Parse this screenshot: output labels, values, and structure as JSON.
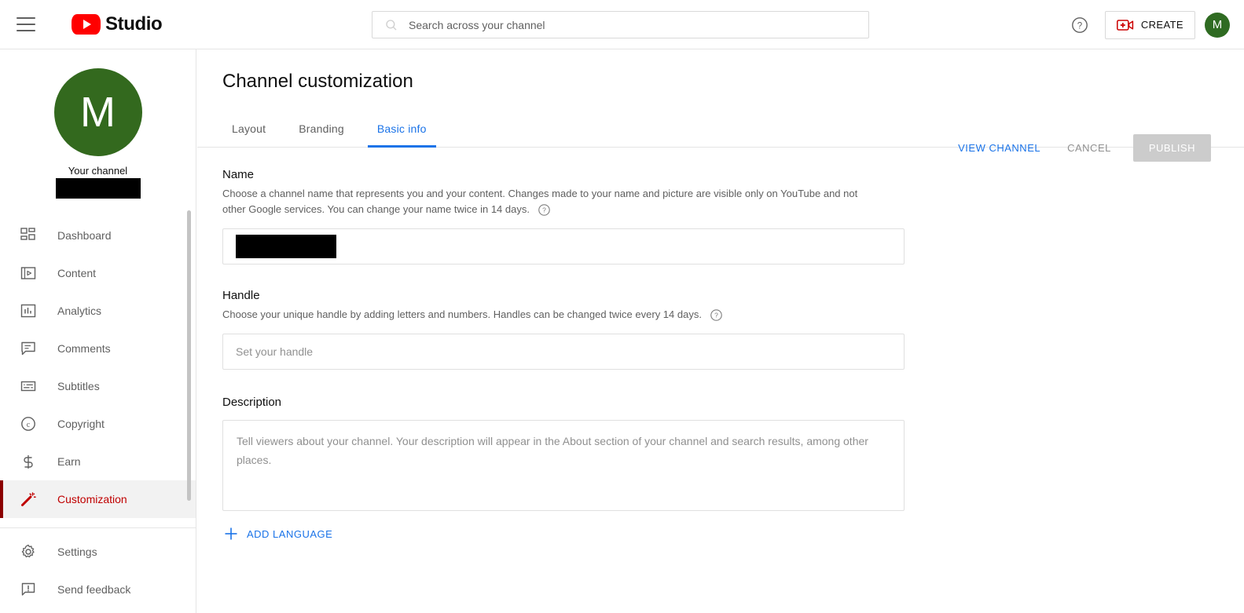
{
  "topbar": {
    "menu_icon": "hamburger-icon",
    "brand": "Studio",
    "logo_icon": "youtube-logo-icon",
    "search": {
      "placeholder": "Search across your channel",
      "value": "",
      "icon": "search-icon"
    },
    "help_icon": "help-circle-icon",
    "create": {
      "label": "CREATE",
      "icon": "video-plus-icon"
    },
    "account_avatar_initial": "M"
  },
  "sidebar": {
    "avatar_initial": "M",
    "your_channel_label": "Your channel",
    "channel_name_redacted": "",
    "items": [
      {
        "label": "Dashboard",
        "icon": "dashboard-grid-icon",
        "active": false
      },
      {
        "label": "Content",
        "icon": "video-frame-icon",
        "active": false
      },
      {
        "label": "Analytics",
        "icon": "bar-chart-icon",
        "active": false
      },
      {
        "label": "Comments",
        "icon": "comment-bubble-icon",
        "active": false
      },
      {
        "label": "Subtitles",
        "icon": "subtitles-icon",
        "active": false
      },
      {
        "label": "Copyright",
        "icon": "copyright-icon",
        "active": false
      },
      {
        "label": "Earn",
        "icon": "dollar-sign-icon",
        "active": false
      },
      {
        "label": "Customization",
        "icon": "magic-wand-icon",
        "active": true
      }
    ],
    "footer_items": [
      {
        "label": "Settings",
        "icon": "gear-icon"
      },
      {
        "label": "Send feedback",
        "icon": "feedback-icon"
      }
    ]
  },
  "page": {
    "title": "Channel customization",
    "tabs": [
      {
        "label": "Layout",
        "active": false
      },
      {
        "label": "Branding",
        "active": false
      },
      {
        "label": "Basic info",
        "active": true
      }
    ],
    "actions": {
      "view_channel": "VIEW CHANNEL",
      "cancel": "CANCEL",
      "publish": "PUBLISH"
    }
  },
  "form": {
    "name": {
      "label": "Name",
      "description": "Choose a channel name that represents you and your content. Changes made to your name and picture are visible only on YouTube and not other Google services. You can change your name twice in 14 days.",
      "help_icon": "help-circle-icon",
      "value_redacted": "",
      "placeholder": ""
    },
    "handle": {
      "label": "Handle",
      "description": "Choose your unique handle by adding letters and numbers. Handles can be changed twice every 14 days.",
      "help_icon": "help-circle-icon",
      "value": "",
      "placeholder": "Set your handle"
    },
    "description": {
      "label": "Description",
      "value": "",
      "placeholder": "Tell viewers about your channel. Your description will appear in the About section of your channel and search results, among other places."
    },
    "add_language": {
      "label": "ADD LANGUAGE",
      "icon": "plus-icon"
    }
  },
  "colors": {
    "youtube_red": "#ff0000",
    "accent_blue": "#1a73e8",
    "active_red": "#c00000",
    "avatar_green": "#33691e",
    "disabled_gray": "#cccccc"
  }
}
